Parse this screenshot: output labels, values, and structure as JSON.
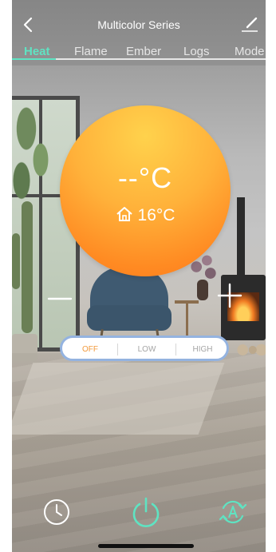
{
  "header": {
    "title": "Multicolor Series",
    "tabs": [
      {
        "label": "Heat",
        "active": true
      },
      {
        "label": "Flame",
        "active": false
      },
      {
        "label": "Ember",
        "active": false
      },
      {
        "label": "Logs",
        "active": false
      },
      {
        "label": "Mode",
        "active": false
      }
    ]
  },
  "thermostat": {
    "set_temperature": "--°C",
    "room_temperature": "16°C"
  },
  "heat_level": {
    "options": [
      "OFF",
      "LOW",
      "HIGH"
    ],
    "selected": "OFF"
  },
  "colors": {
    "accent_tab": "#5fe3c2",
    "circle_top": "#ffd24c",
    "circle_bottom": "#fb7a1d",
    "selected_level": "#f29a3c",
    "power_icon": "#5fe3c2",
    "auto_icon": "#5fe3c2"
  },
  "icons": {
    "back": "chevron-left-icon",
    "edit": "pen-icon",
    "home": "house-icon",
    "timer": "clock-icon",
    "power": "power-icon",
    "auto": "auto-cycle-icon"
  }
}
